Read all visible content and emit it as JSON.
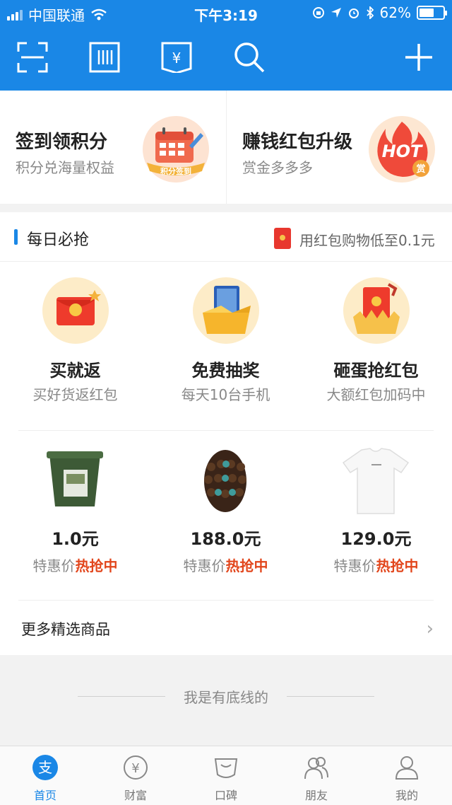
{
  "status": {
    "carrier": "中国联通",
    "time": "下午3:19",
    "battery": "62%",
    "battery_level": 0.62
  },
  "toolbar": {
    "icons": [
      "scan-icon",
      "barcode-icon",
      "wallet-icon",
      "search-icon",
      "add-icon"
    ]
  },
  "cards": [
    {
      "title": "签到领积分",
      "subtitle": "积分兑海量权益",
      "badge_text": "积分签到"
    },
    {
      "title": "赚钱红包升级",
      "subtitle": "赏金多多多",
      "badge_text": "HOT",
      "badge_sub": "赏"
    }
  ],
  "daily": {
    "title": "每日必抢",
    "tip": "用红包购物低至0.1元",
    "promos": [
      {
        "title": "买就返",
        "subtitle": "买好货返红包"
      },
      {
        "title": "免费抽奖",
        "subtitle": "每天10台手机"
      },
      {
        "title": "砸蛋抢红包",
        "subtitle": "大额红包加码中"
      }
    ],
    "products": [
      {
        "price": "1.0元",
        "label": "特惠价",
        "hot": "热抢中"
      },
      {
        "price": "188.0元",
        "label": "特惠价",
        "hot": "热抢中"
      },
      {
        "price": "129.0元",
        "label": "特惠价",
        "hot": "热抢中"
      }
    ],
    "more": "更多精选商品"
  },
  "footer_text": "我是有底线的",
  "tabs": [
    {
      "label": "首页",
      "icon": "alipay-home-icon",
      "active": true
    },
    {
      "label": "财富",
      "icon": "yen-icon",
      "active": false
    },
    {
      "label": "口碑",
      "icon": "koubei-icon",
      "active": false
    },
    {
      "label": "朋友",
      "icon": "friends-icon",
      "active": false
    },
    {
      "label": "我的",
      "icon": "profile-icon",
      "active": false
    }
  ],
  "colors": {
    "brand": "#1a87e6",
    "hot": "#e2461c",
    "red_envelope": "#e8372e"
  }
}
